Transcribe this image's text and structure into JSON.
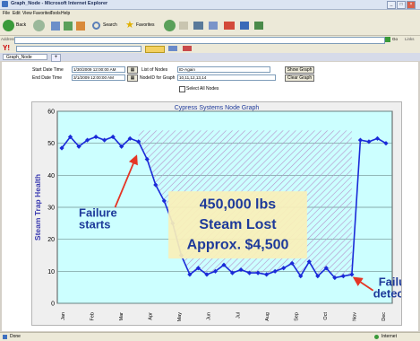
{
  "window": {
    "title": "Graph_Node - Microsoft Internet Explorer"
  },
  "menu": [
    "File",
    "Edit",
    "View",
    "Favorites",
    "Tools",
    "Help"
  ],
  "toolbar": {
    "back": "Back",
    "search": "Search",
    "favorites": "Favorites"
  },
  "address": {
    "label": "Address",
    "go": "Go",
    "links": "Links"
  },
  "tab": {
    "label": "Graph_Node"
  },
  "form": {
    "start_label": "Start Date Time",
    "start_value": "1/30/2009 12:00:00 AM",
    "end_label": "End Date Time",
    "end_value": "3/1/2009 12:00:00 AM",
    "list_label": "List of Nodes",
    "list_value": "ID-Again",
    "nodeid_label": "NodeID for Graph",
    "nodeid_value": "10,11,12,13,14",
    "select_all": "Select All Nodes",
    "show_button": "Show Graph",
    "clear_button": "Clear Graph"
  },
  "status": {
    "left": "Done",
    "right": "Internet"
  },
  "colors": {
    "plot_bg": "#ccffff",
    "line": "#1a2ad8",
    "callout_fill": "#faf0b8",
    "annotation": "#1e3a9a",
    "arrow": "#e53525"
  },
  "chart_data": {
    "type": "line",
    "title": "Cypress Systems Node Graph",
    "ylabel": "Steam Trap Health",
    "xlabel": "",
    "ylim": [
      0,
      60
    ],
    "yticks": [
      0,
      10,
      20,
      30,
      40,
      50,
      60
    ],
    "xticks": [
      "Jan",
      "Feb",
      "Mar",
      "Apr",
      "May",
      "Jun",
      "Jul",
      "Aug",
      "Sep",
      "Oct",
      "Nov",
      "Dec"
    ],
    "grid": true,
    "series": [
      {
        "values": [
          [
            0.0,
            48.5
          ],
          [
            0.4,
            52
          ],
          [
            0.8,
            49
          ],
          [
            1.2,
            51
          ],
          [
            1.6,
            52
          ],
          [
            2.0,
            51
          ],
          [
            2.4,
            52
          ],
          [
            2.8,
            49
          ],
          [
            3.2,
            51.5
          ],
          [
            3.6,
            50.5
          ],
          [
            4.0,
            45
          ],
          [
            4.4,
            37
          ],
          [
            4.8,
            32
          ],
          [
            5.2,
            25
          ],
          [
            5.6,
            15
          ],
          [
            6.0,
            9
          ],
          [
            6.4,
            11
          ],
          [
            6.8,
            9
          ],
          [
            7.2,
            10
          ],
          [
            7.6,
            12
          ],
          [
            8.0,
            9.5
          ],
          [
            8.4,
            10.5
          ],
          [
            8.8,
            9.5
          ],
          [
            9.2,
            9.5
          ],
          [
            9.6,
            9
          ],
          [
            10.0,
            10
          ],
          [
            10.4,
            11
          ],
          [
            10.8,
            12.5
          ],
          [
            11.2,
            8.5
          ],
          [
            11.6,
            13
          ],
          [
            12.0,
            8.5
          ],
          [
            12.4,
            11
          ],
          [
            12.8,
            8
          ],
          [
            13.2,
            8.5
          ],
          [
            13.6,
            9
          ],
          [
            14.0,
            51
          ],
          [
            14.4,
            50.5
          ],
          [
            14.8,
            51.5
          ],
          [
            15.2,
            50
          ]
        ]
      }
    ],
    "annotations": {
      "failure_starts": "Failure starts",
      "steam_lost_line1": "450,000 lbs",
      "steam_lost_line2": "Steam Lost",
      "steam_lost_line3": "Approx. $4,500",
      "failure_detected": "Failure detected"
    }
  }
}
